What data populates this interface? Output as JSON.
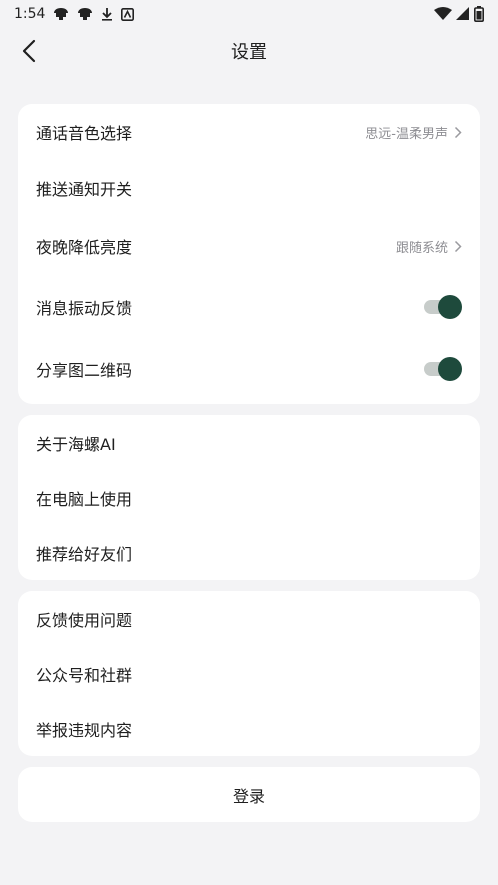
{
  "status_bar": {
    "time": "1:54",
    "icons_left": [
      "notification-icon",
      "notification-icon",
      "download-icon",
      "app-icon"
    ],
    "icons_right": [
      "wifi-icon",
      "signal-icon",
      "battery-icon"
    ]
  },
  "header": {
    "title": "设置",
    "back_icon": "chevron-left-icon"
  },
  "section1": {
    "items": [
      {
        "label": "通话音色选择",
        "value": "思远-温柔男声",
        "control": "chevron"
      },
      {
        "label": "推送通知开关",
        "value": "",
        "control": "none"
      },
      {
        "label": "夜晚降低亮度",
        "value": "跟随系统",
        "control": "chevron"
      },
      {
        "label": "消息振动反馈",
        "control": "toggle",
        "on": true
      },
      {
        "label": "分享图二维码",
        "control": "toggle",
        "on": true
      }
    ]
  },
  "section2": {
    "items": [
      {
        "label": "关于海螺AI"
      },
      {
        "label": "在电脑上使用"
      },
      {
        "label": "推荐给好友们"
      }
    ]
  },
  "section3": {
    "items": [
      {
        "label": "反馈使用问题"
      },
      {
        "label": "公众号和社群"
      },
      {
        "label": "举报违规内容"
      }
    ]
  },
  "login": {
    "label": "登录"
  },
  "colors": {
    "background": "#f3f3f5",
    "card": "#ffffff",
    "toggle_on": "#1e4a3c",
    "secondary_text": "#8e8e93"
  }
}
